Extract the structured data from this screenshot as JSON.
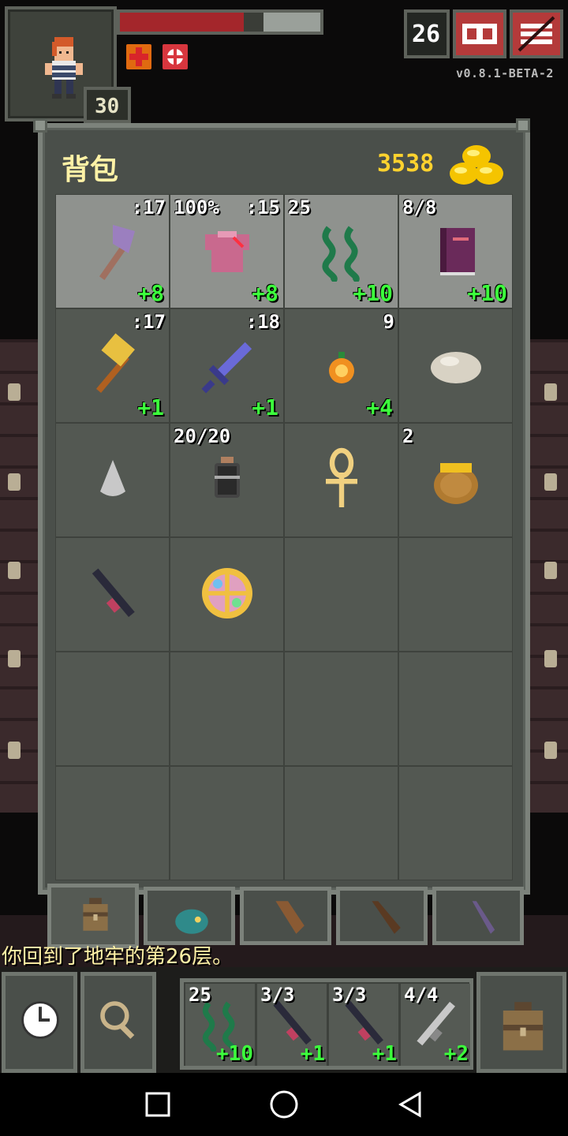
{
  "hud": {
    "hero_level": "30",
    "hp_fraction": 0.62,
    "depth": "26",
    "version": "v0.8.1-BETA-2",
    "buffs": [
      "healing-buff-icon",
      "bless-buff-icon"
    ]
  },
  "backpack": {
    "title": "背包",
    "gold": "3538",
    "slots": [
      {
        "icon": "axe-icon",
        "top_left": "",
        "top_right": ":17",
        "bottom_right": "+8",
        "equipped": true
      },
      {
        "icon": "armor-icon",
        "top_left": "100%",
        "top_right": ":15",
        "bottom_right": "+8",
        "equipped": true
      },
      {
        "icon": "chain-whip-icon",
        "top_left": "25",
        "top_right": "",
        "bottom_right": "+10",
        "equipped": true
      },
      {
        "icon": "spellbook-icon",
        "top_left": "8/8",
        "top_right": "",
        "bottom_right": "+10",
        "equipped": true
      },
      {
        "icon": "hammer-icon",
        "top_left": "",
        "top_right": ":17",
        "bottom_right": "+1",
        "equipped": false
      },
      {
        "icon": "sword-icon",
        "top_left": "",
        "top_right": ":18",
        "bottom_right": "+1",
        "equipped": false
      },
      {
        "icon": "amulet-icon",
        "top_left": "",
        "top_right": "9",
        "bottom_right": "+4",
        "equipped": false
      },
      {
        "icon": "stone-icon",
        "top_left": "",
        "top_right": "",
        "bottom_right": "",
        "equipped": false
      },
      {
        "icon": "dust-icon",
        "top_left": "",
        "top_right": "",
        "bottom_right": "",
        "equipped": false
      },
      {
        "icon": "dew-vial-icon",
        "top_left": "20/20",
        "top_right": "",
        "bottom_right": "",
        "equipped": false
      },
      {
        "icon": "ankh-icon",
        "top_left": "",
        "top_right": "",
        "bottom_right": "",
        "equipped": false
      },
      {
        "icon": "honeypot-icon",
        "top_left": "2",
        "top_right": "",
        "bottom_right": "",
        "equipped": false
      },
      {
        "icon": "wand-icon",
        "top_left": "",
        "top_right": "",
        "bottom_right": "",
        "equipped": false
      },
      {
        "icon": "alchemy-disc-icon",
        "top_left": "",
        "top_right": "",
        "bottom_right": "",
        "equipped": false
      }
    ],
    "tabs": [
      "backpack-tab-icon",
      "seed-pouch-tab-icon",
      "scroll-holder-tab-icon",
      "wand-holster-tab-icon",
      "staff-tab-icon"
    ]
  },
  "log": {
    "message": "你回到了地牢的第26层。"
  },
  "toolbar": {
    "quickslots": [
      {
        "icon": "chain-whip-icon",
        "top_left": "25",
        "bottom_right": "+10"
      },
      {
        "icon": "wand-icon",
        "top_left": "3/3",
        "bottom_right": "+1"
      },
      {
        "icon": "wand-icon",
        "top_left": "3/3",
        "bottom_right": "+1"
      },
      {
        "icon": "wand-light-icon",
        "top_left": "4/4",
        "bottom_right": "+2"
      }
    ]
  },
  "colors": {
    "hp": "#a4262b",
    "gold": "#ffd22e",
    "upgrade": "#3cff3c",
    "title": "#fff2a6",
    "panel": "#4a4f4a"
  }
}
